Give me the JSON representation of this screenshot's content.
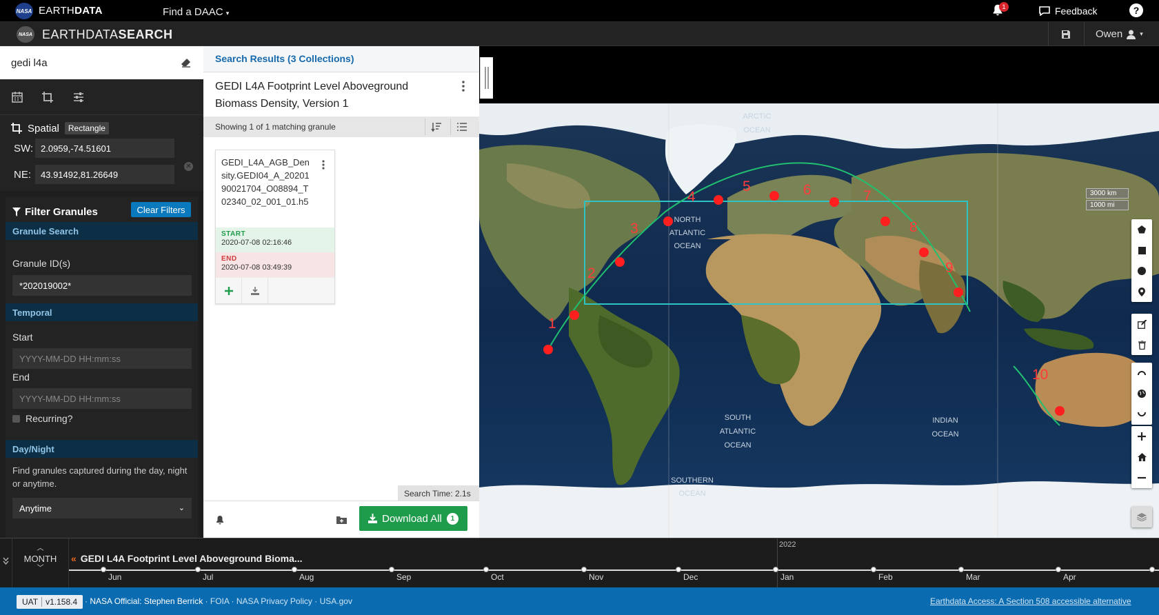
{
  "topbar": {
    "nasa_logo": "NASA",
    "brand_light": "EARTH",
    "brand_bold": "DATA",
    "daac_label": "Find a DAAC",
    "notification_count": "1",
    "feedback_label": "Feedback",
    "help_label": "?"
  },
  "appbar": {
    "title_light": "EARTHDATA",
    "title_bold": "SEARCH",
    "user_name": "Owen",
    "save_icon": "save-icon"
  },
  "sidebar": {
    "search_value": "gedi l4a",
    "spatial": {
      "heading": "Spatial",
      "type": "Rectangle",
      "sw_label": "SW:",
      "sw_value": "2.0959,-74.51601",
      "ne_label": "NE:",
      "ne_value": "43.91492,81.26649"
    },
    "filters": {
      "heading": "Filter Granules",
      "clear_label": "Clear Filters",
      "granule_search_heading": "Granule Search",
      "granule_ids_label": "Granule ID(s)",
      "granule_ids_value": "*202019002*",
      "temporal_heading": "Temporal",
      "start_label": "Start",
      "start_placeholder": "YYYY-MM-DD HH:mm:ss",
      "end_label": "End",
      "end_placeholder": "YYYY-MM-DD HH:mm:ss",
      "recurring_label": "Recurring?",
      "daynight_heading": "Day/Night",
      "daynight_desc": "Find granules captured during the day, night or anytime.",
      "daynight_value": "Anytime"
    }
  },
  "results": {
    "tab_label": "Search Results (3 Collections)",
    "collection_title": "GEDI L4A Footprint Level Aboveground Biomass Density, Version 1",
    "showing": "Showing 1 of 1 matching granule",
    "granule": {
      "name": "GEDI_L4A_AGB_Density.GEDI04_A_2020190021704_O08894_T02340_02_001_01.h5",
      "start_label": "START",
      "start_value": "2020-07-08 02:16:46",
      "end_label": "END",
      "end_value": "2020-07-08 03:49:39"
    },
    "search_time": "Search Time: 2.1s",
    "download_label": "Download All",
    "download_count": "1"
  },
  "map": {
    "labels": [
      {
        "text": "ARCTIC"
      },
      {
        "text": "OCEAN"
      },
      {
        "text": "NORTH"
      },
      {
        "text": "ATLANTIC"
      },
      {
        "text": "OCEAN"
      },
      {
        "text": "SOUTH"
      },
      {
        "text": "ATLANTIC"
      },
      {
        "text": "OCEAN"
      },
      {
        "text": "INDIAN"
      },
      {
        "text": "OCEAN"
      },
      {
        "text": "SOUTHERN"
      },
      {
        "text": "OCEAN"
      }
    ],
    "track_numbers": [
      "1",
      "2",
      "3",
      "4",
      "5",
      "6",
      "7",
      "8",
      "9",
      "10"
    ],
    "scale_km": "3000 km",
    "scale_mi": "1000 mi",
    "colors": {
      "track_marker": "#ff1f1f",
      "track_number": "#ff3b3b",
      "orbit_line": "#20c070",
      "bbox": "#2ec4c4"
    }
  },
  "timeline": {
    "zoom_label": "MONTH",
    "product": "GEDI L4A Footprint Level Aboveground Bioma...",
    "year_label": "2022",
    "months": [
      "Jun",
      "Jul",
      "Aug",
      "Sep",
      "Oct",
      "Nov",
      "Dec",
      "Jan",
      "Feb",
      "Mar",
      "Apr"
    ]
  },
  "footer": {
    "env": "UAT",
    "version": "v1.158.4",
    "official": "NASA Official: Stephen Berrick",
    "foia": "FOIA",
    "privacy": "NASA Privacy Policy",
    "usagov": "USA.gov",
    "accessibility": "Earthdata Access: A Section 508 accessible alternative"
  }
}
